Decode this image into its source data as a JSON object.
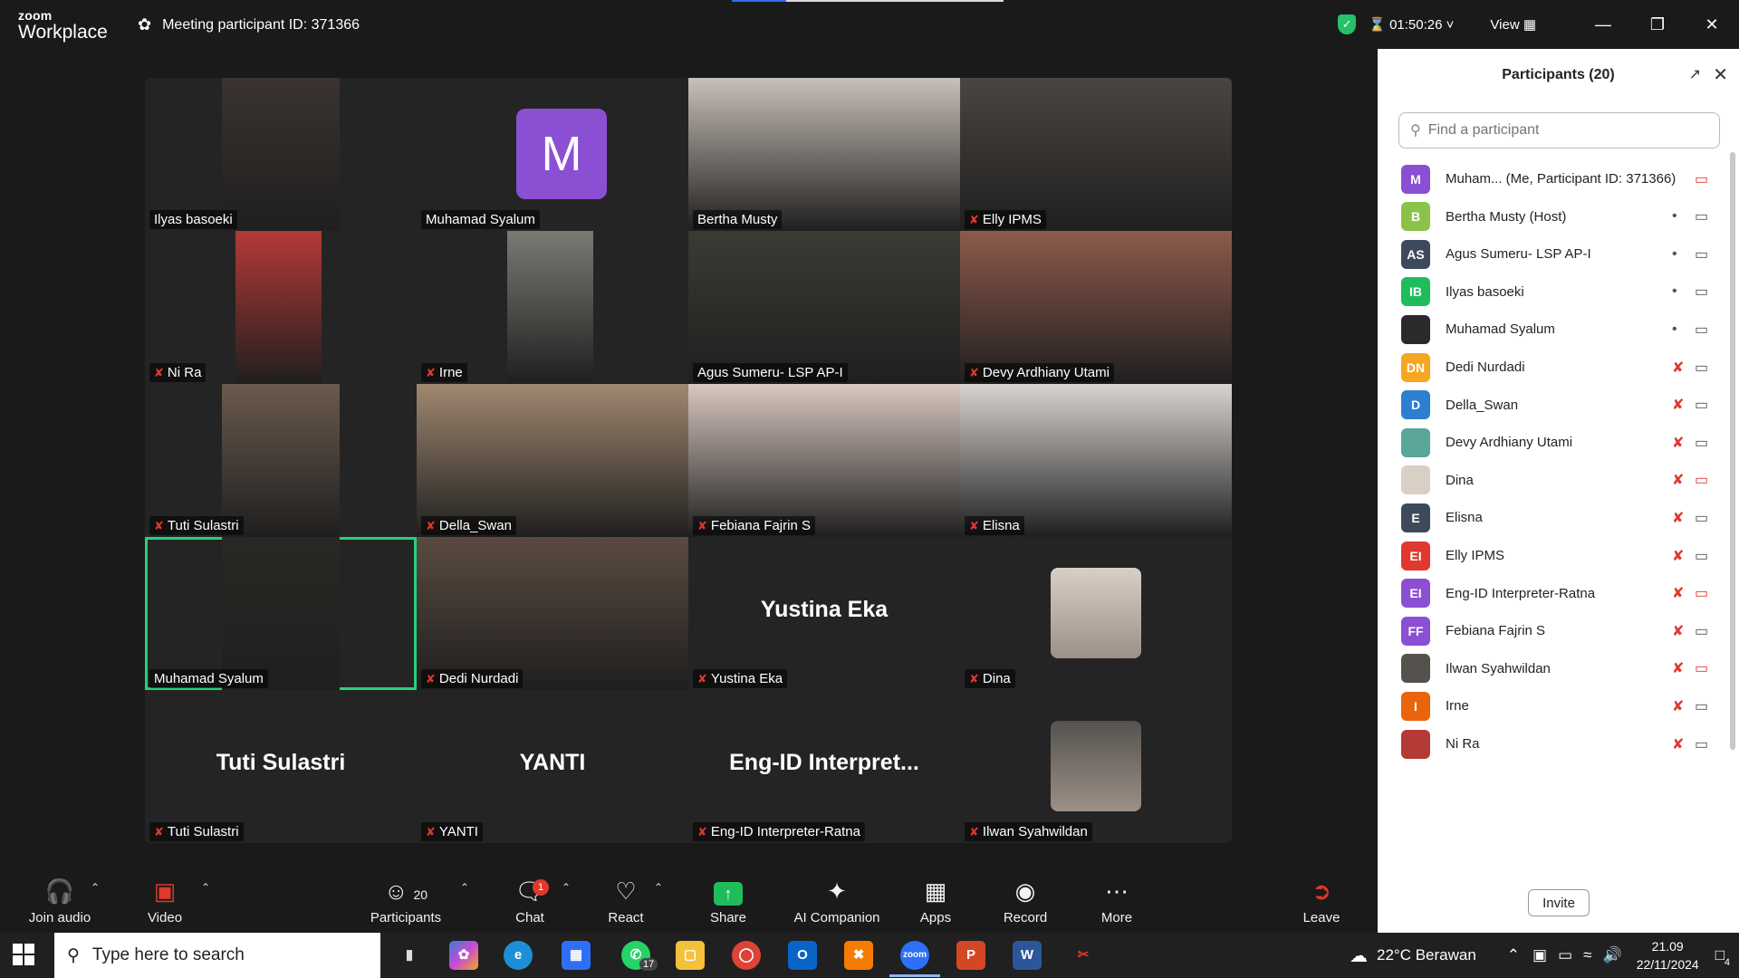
{
  "app": {
    "logo_line1": "zoom",
    "logo_line2": "Workplace",
    "meeting_id": "Meeting participant ID: 371366"
  },
  "titlebar": {
    "timer": "01:50:26",
    "view_label": "View"
  },
  "tiles": [
    {
      "name": "Ilyas basoeki",
      "muted": false,
      "kind": "video",
      "bg": "#3a3330"
    },
    {
      "name": "Muhamad Syalum",
      "muted": false,
      "kind": "avatar",
      "avatar_letter": "M"
    },
    {
      "name": "Bertha Musty",
      "muted": false,
      "kind": "video",
      "bg": "#c9c0b8"
    },
    {
      "name": "Elly IPMS",
      "muted": true,
      "kind": "video",
      "bg": "#4a4540"
    },
    {
      "name": "Ni Ra",
      "muted": true,
      "kind": "video",
      "bg": "#b43a36"
    },
    {
      "name": "Irne",
      "muted": true,
      "kind": "video",
      "bg": "#7a7a74"
    },
    {
      "name": "Agus Sumeru- LSP AP-I",
      "muted": false,
      "kind": "video",
      "bg": "#3c3a34"
    },
    {
      "name": "Devy Ardhiany Utami",
      "muted": true,
      "kind": "video",
      "bg": "#8e5a4a"
    },
    {
      "name": "Tuti  Sulastri",
      "muted": true,
      "kind": "video",
      "bg": "#6a5a4c"
    },
    {
      "name": "Della_Swan",
      "muted": true,
      "kind": "video",
      "bg": "#a08870"
    },
    {
      "name": "Febiana Fajrin S",
      "muted": true,
      "kind": "video",
      "bg": "#d8c8c0"
    },
    {
      "name": "Elisna",
      "muted": true,
      "kind": "video",
      "bg": "#d8d4d0"
    },
    {
      "name": "Muhamad Syalum",
      "muted": false,
      "kind": "video",
      "bg": "#2a2824",
      "active": true
    },
    {
      "name": "Dedi Nurdadi",
      "muted": true,
      "kind": "video",
      "bg": "#5a4a40"
    },
    {
      "name": "Yustina Eka",
      "muted": true,
      "kind": "text",
      "big": "Yustina Eka"
    },
    {
      "name": "Dina",
      "muted": true,
      "kind": "photo",
      "bg": "#d9cfc4"
    },
    {
      "name": "Tuti Sulastri",
      "muted": true,
      "kind": "text",
      "big": "Tuti Sulastri"
    },
    {
      "name": "YANTI",
      "muted": true,
      "kind": "text",
      "big": "YANTI"
    },
    {
      "name": "Eng-ID Interpreter-Ratna",
      "muted": true,
      "kind": "text",
      "big": "Eng-ID  Interpret..."
    },
    {
      "name": "Ilwan Syahwildan",
      "muted": true,
      "kind": "photo",
      "bg": "#55524e"
    }
  ],
  "panel": {
    "title": "Participants (20)",
    "search_placeholder": "Find a participant",
    "invite_label": "Invite",
    "participants": [
      {
        "initials": "M",
        "color": "#8b4fd4",
        "name": "Muham...   (Me, Participant ID: 371366)",
        "mic": "none",
        "cam": "off"
      },
      {
        "initials": "B",
        "color": "#8bc34a",
        "name": "Bertha Musty (Host)",
        "mic": "on",
        "cam": "on"
      },
      {
        "initials": "AS",
        "color": "#3c4a5c",
        "name": "Agus Sumeru- LSP AP-I",
        "mic": "on",
        "cam": "on"
      },
      {
        "initials": "IB",
        "color": "#1fbc5b",
        "name": "Ilyas basoeki",
        "mic": "on",
        "cam": "on"
      },
      {
        "initials": "",
        "color": "#2a2a2a",
        "name": "Muhamad Syalum",
        "mic": "on",
        "cam": "on"
      },
      {
        "initials": "DN",
        "color": "#f5a623",
        "name": "Dedi Nurdadi",
        "mic": "muted",
        "cam": "on"
      },
      {
        "initials": "D",
        "color": "#2d7fd0",
        "name": "Della_Swan",
        "mic": "muted",
        "cam": "on"
      },
      {
        "initials": "",
        "color": "#5aa69a",
        "name": "Devy Ardhiany Utami",
        "mic": "muted",
        "cam": "on"
      },
      {
        "initials": "",
        "color": "#d9cfc4",
        "name": "Dina",
        "mic": "muted",
        "cam": "off"
      },
      {
        "initials": "E",
        "color": "#3c4a5c",
        "name": "Elisna",
        "mic": "muted",
        "cam": "on"
      },
      {
        "initials": "EI",
        "color": "#e0382e",
        "name": "Elly IPMS",
        "mic": "muted",
        "cam": "on"
      },
      {
        "initials": "EI",
        "color": "#8b4fd4",
        "name": "Eng-ID Interpreter-Ratna",
        "mic": "muted",
        "cam": "off"
      },
      {
        "initials": "FF",
        "color": "#8b4fd4",
        "name": "Febiana Fajrin S",
        "mic": "muted",
        "cam": "on"
      },
      {
        "initials": "",
        "color": "#55524e",
        "name": "Ilwan Syahwildan",
        "mic": "muted",
        "cam": "off"
      },
      {
        "initials": "I",
        "color": "#e8650c",
        "name": "Irne",
        "mic": "muted",
        "cam": "on"
      },
      {
        "initials": "",
        "color": "#b43a36",
        "name": "Ni Ra",
        "mic": "muted",
        "cam": "on"
      }
    ]
  },
  "toolbar": {
    "join_audio": "Join audio",
    "video": "Video",
    "participants": "Participants",
    "participants_count": "20",
    "chat": "Chat",
    "chat_badge": "1",
    "react": "React",
    "share": "Share",
    "ai_companion": "AI Companion",
    "apps": "Apps",
    "record": "Record",
    "more": "More",
    "leave": "Leave"
  },
  "taskbar": {
    "search_placeholder": "Type here to search",
    "whatsapp_badge": "17",
    "weather": "22°C  Berawan",
    "time": "21.09",
    "date": "22/11/2024",
    "notifications": "4"
  }
}
